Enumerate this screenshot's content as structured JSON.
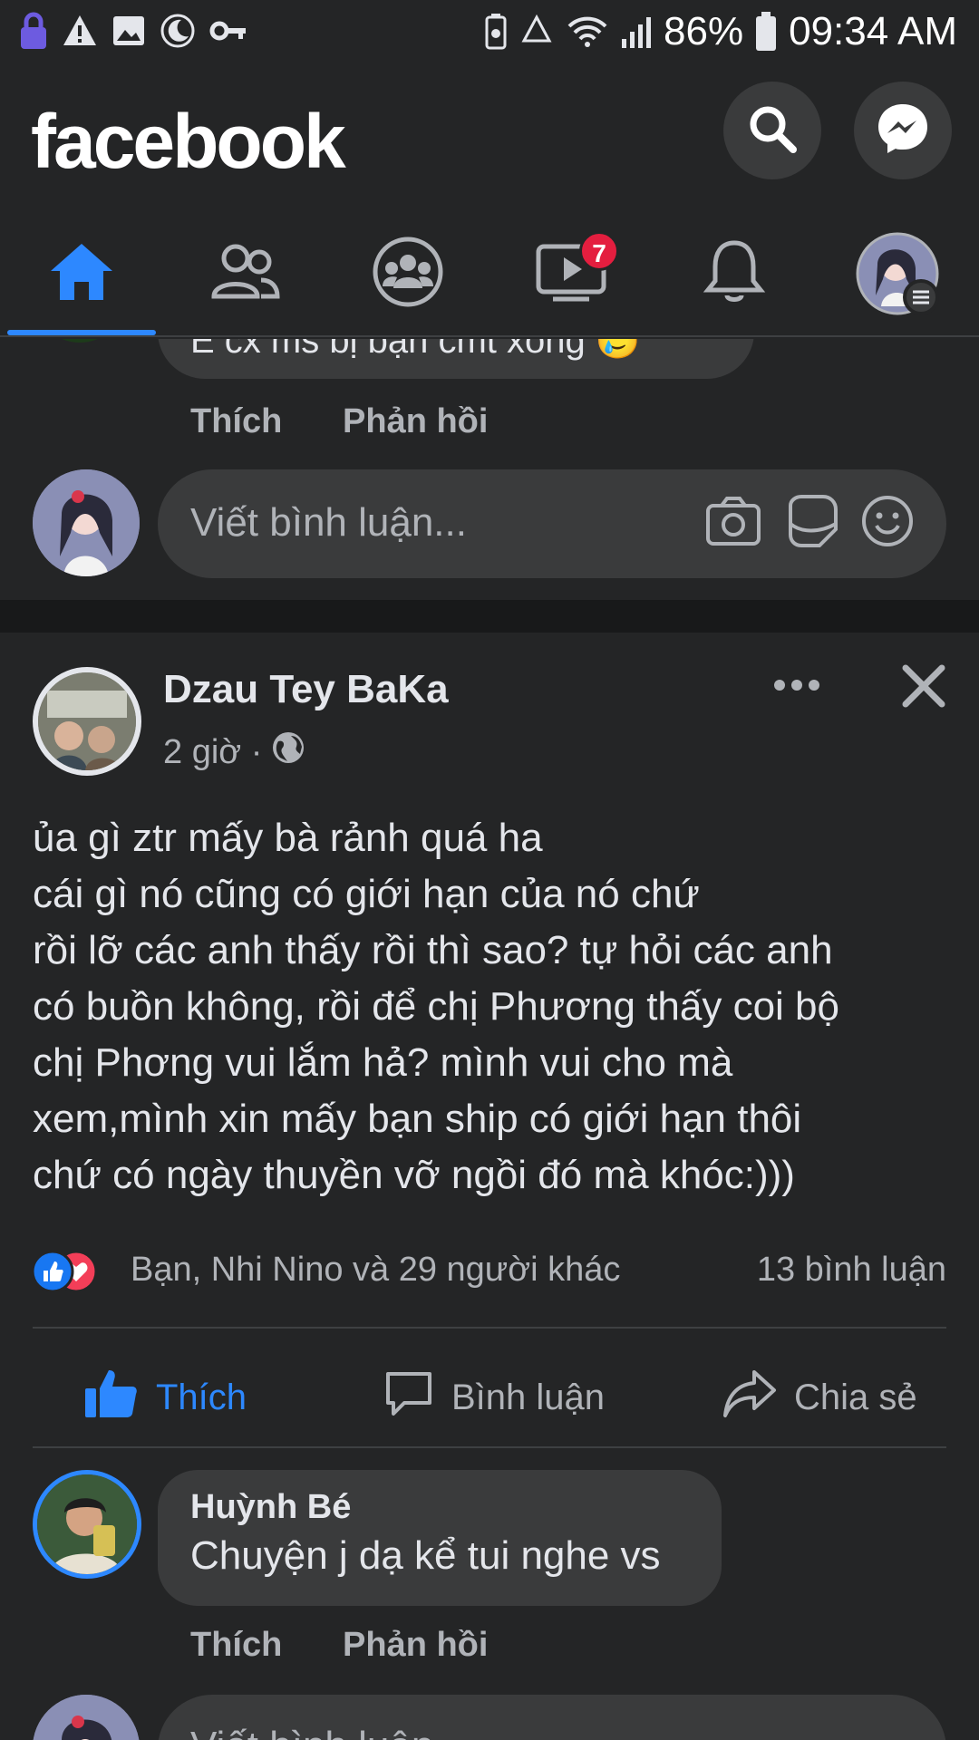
{
  "status_bar": {
    "battery": "86%",
    "time": "09:34 AM",
    "left_icons": [
      "lock-icon",
      "warning-icon",
      "image-icon",
      "moon-icon",
      "key-icon"
    ],
    "right_icons": [
      "battery-saver-icon",
      "recycle-icon",
      "wifi-icon",
      "signal-icon",
      "battery-icon"
    ]
  },
  "header": {
    "logo": "facebook",
    "buttons": [
      "search-icon",
      "messenger-icon"
    ]
  },
  "tabs": [
    {
      "name": "home",
      "icon": "home-icon",
      "active": true
    },
    {
      "name": "friends",
      "icon": "friends-icon"
    },
    {
      "name": "groups",
      "icon": "groups-icon"
    },
    {
      "name": "watch",
      "icon": "watch-icon",
      "badge": "7"
    },
    {
      "name": "notifications",
      "icon": "bell-icon"
    },
    {
      "name": "menu",
      "icon": "profile-menu-icon"
    }
  ],
  "prev_comment": {
    "text_partial": "E cx ms bị bạn cmt xong 🥲",
    "like": "Thích",
    "reply": "Phản hồi"
  },
  "comment_input_1": {
    "placeholder": "Viết bình luận...",
    "icons": [
      "camera-icon",
      "sticker-icon",
      "emoji-icon"
    ]
  },
  "post": {
    "author": "Dzau Tey BaKa",
    "time": "2 giờ ·",
    "privacy_icon": "globe-icon",
    "more_icon": "more-icon",
    "close_icon": "close-icon",
    "body_lines": [
      "ủa gì ztr mấy bà rảnh quá ha",
      "cái gì nó cũng có giới hạn của nó chứ",
      "rồi lỡ các anh thấy rồi thì sao? tự hỏi các anh",
      "có buồn không, rồi để chị Phương thấy coi bộ",
      "chị Phơng vui lắm hả? mình vui cho mà",
      "xem,mình xin mấy bạn ship có giới hạn thôi",
      "chứ có ngày thuyền vỡ ngồi đó mà khóc:)))"
    ],
    "reactions_text": "Bạn, Nhi Nino và 29 người khác",
    "comments_count": "13 bình luận",
    "actions": {
      "like": "Thích",
      "comment": "Bình luận",
      "share": "Chia sẻ"
    }
  },
  "comment_2": {
    "author": "Huỳnh Bé",
    "text": "Chuyện j dạ kể tui nghe vs",
    "like": "Thích",
    "reply": "Phản hồi"
  },
  "comment_input_2": {
    "placeholder": "Viết bình luận..."
  },
  "colors": {
    "background": "#242526",
    "accent": "#2d88ff",
    "badge": "#e41e3f",
    "bubble": "#3a3b3c",
    "secondary_text": "#b0b3b8"
  }
}
